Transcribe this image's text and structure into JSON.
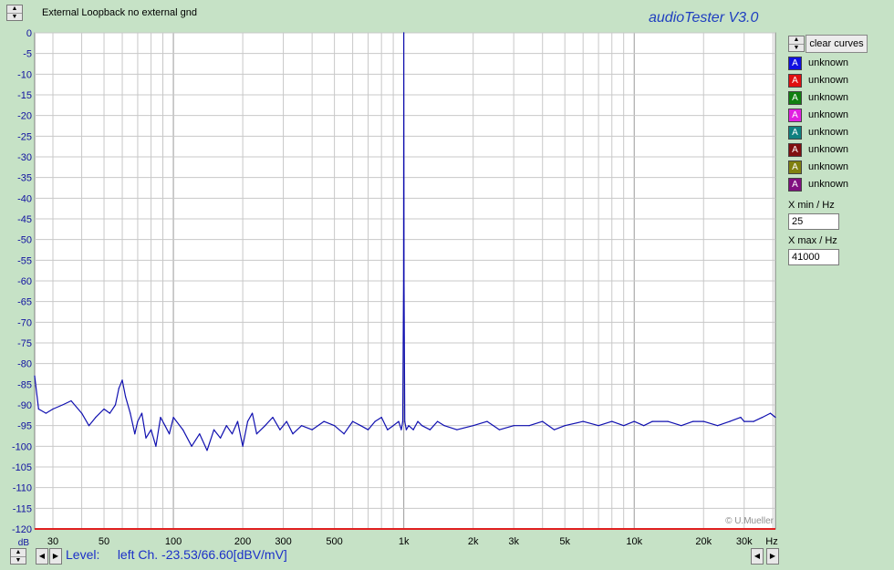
{
  "header": {
    "title": "External Loopback no external  gnd",
    "brand": "audioTester  V3.0"
  },
  "sidebar": {
    "clear_label": "clear curves",
    "legend": [
      {
        "label": "unknown",
        "color": "#1010e0"
      },
      {
        "label": "unknown",
        "color": "#e01010"
      },
      {
        "label": "unknown",
        "color": "#108010"
      },
      {
        "label": "unknown",
        "color": "#e020e0"
      },
      {
        "label": "unknown",
        "color": "#108080"
      },
      {
        "label": "unknown",
        "color": "#801010"
      },
      {
        "label": "unknown",
        "color": "#808010"
      },
      {
        "label": "unknown",
        "color": "#801080"
      }
    ],
    "legend_glyph": "A",
    "xmin_label": "X min / Hz",
    "xmin_value": "25",
    "xmax_label": "X max / Hz",
    "xmax_value": "41000"
  },
  "status": {
    "label": "Level:",
    "text": "left Ch. -23.53/66.60[dBV/mV]"
  },
  "chart_data": {
    "type": "line",
    "title": "",
    "xlabel": "Hz",
    "ylabel": "dB",
    "x_scale": "log",
    "xlim": [
      25,
      41000
    ],
    "ylim": [
      -120,
      0
    ],
    "grid": true,
    "y_ticks": [
      0,
      -5,
      -10,
      -15,
      -20,
      -25,
      -30,
      -35,
      -40,
      -45,
      -50,
      -55,
      -60,
      -65,
      -70,
      -75,
      -80,
      -85,
      -90,
      -95,
      -100,
      -105,
      -110,
      -115,
      -120
    ],
    "x_tick_labels": [
      {
        "x": 30,
        "label": "30"
      },
      {
        "x": 50,
        "label": "50"
      },
      {
        "x": 100,
        "label": "100"
      },
      {
        "x": 200,
        "label": "200"
      },
      {
        "x": 300,
        "label": "300"
      },
      {
        "x": 500,
        "label": "500"
      },
      {
        "x": 1000,
        "label": "1k"
      },
      {
        "x": 2000,
        "label": "2k"
      },
      {
        "x": 3000,
        "label": "3k"
      },
      {
        "x": 5000,
        "label": "5k"
      },
      {
        "x": 10000,
        "label": "10k"
      },
      {
        "x": 20000,
        "label": "20k"
      },
      {
        "x": 30000,
        "label": "30k"
      }
    ],
    "watermark": "© U.Mueller",
    "series": [
      {
        "color": "#1010b0",
        "x": [
          25,
          26,
          28,
          30,
          33,
          36,
          40,
          43,
          46,
          50,
          53,
          56,
          58,
          60,
          62,
          65,
          68,
          70,
          73,
          76,
          80,
          84,
          88,
          92,
          96,
          100,
          110,
          120,
          130,
          140,
          150,
          160,
          170,
          180,
          190,
          200,
          210,
          220,
          230,
          250,
          270,
          290,
          310,
          330,
          360,
          400,
          450,
          500,
          550,
          600,
          650,
          700,
          750,
          800,
          850,
          900,
          950,
          975,
          990,
          998,
          1000,
          1002,
          1010,
          1025,
          1050,
          1100,
          1150,
          1200,
          1300,
          1400,
          1500,
          1700,
          2000,
          2300,
          2600,
          3000,
          3500,
          4000,
          4500,
          5000,
          6000,
          7000,
          8000,
          9000,
          10000,
          11000,
          12000,
          14000,
          16000,
          18000,
          20000,
          23000,
          26000,
          29000,
          30000,
          33000,
          36000,
          39000,
          41000
        ],
        "y": [
          -83,
          -91,
          -92,
          -91,
          -90,
          -89,
          -92,
          -95,
          -93,
          -91,
          -92,
          -90,
          -86,
          -84,
          -88,
          -92,
          -97,
          -94,
          -92,
          -98,
          -96,
          -100,
          -93,
          -95,
          -97,
          -93,
          -96,
          -100,
          -97,
          -101,
          -96,
          -98,
          -95,
          -97,
          -94,
          -100,
          -94,
          -92,
          -97,
          -95,
          -93,
          -96,
          -94,
          -97,
          -95,
          -96,
          -94,
          -95,
          -97,
          -94,
          -95,
          -96,
          -94,
          -93,
          -96,
          -95,
          -94,
          -96,
          -94,
          -60,
          0,
          -60,
          -94,
          -96,
          -95,
          -96,
          -94,
          -95,
          -96,
          -94,
          -95,
          -96,
          -95,
          -94,
          -96,
          -95,
          -95,
          -94,
          -96,
          -95,
          -94,
          -95,
          -94,
          -95,
          -94,
          -95,
          -94,
          -94,
          -95,
          -94,
          -94,
          -95,
          -94,
          -93,
          -94,
          -94,
          -93,
          -92,
          -93
        ]
      }
    ]
  }
}
